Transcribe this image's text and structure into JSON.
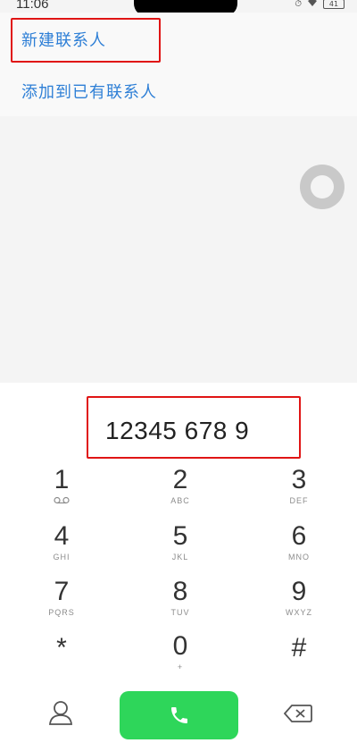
{
  "status_bar": {
    "time": "11:06",
    "battery": "41"
  },
  "menu": {
    "items": [
      {
        "label": "新建联系人"
      },
      {
        "label": "添加到已有联系人"
      }
    ]
  },
  "dialer": {
    "number": "12345 678 9",
    "keys": [
      {
        "digit": "1",
        "letters": "voicemail-icon"
      },
      {
        "digit": "2",
        "letters": "ABC"
      },
      {
        "digit": "3",
        "letters": "DEF"
      },
      {
        "digit": "4",
        "letters": "GHI"
      },
      {
        "digit": "5",
        "letters": "JKL"
      },
      {
        "digit": "6",
        "letters": "MNO"
      },
      {
        "digit": "7",
        "letters": "PQRS"
      },
      {
        "digit": "8",
        "letters": "TUV"
      },
      {
        "digit": "9",
        "letters": "WXYZ"
      },
      {
        "digit": "*",
        "letters": ""
      },
      {
        "digit": "0",
        "letters": "+"
      },
      {
        "digit": "#",
        "letters": ""
      }
    ]
  },
  "colors": {
    "accent": "#2e7fd6",
    "call_button": "#2ed65a",
    "highlight": "#e01515"
  }
}
